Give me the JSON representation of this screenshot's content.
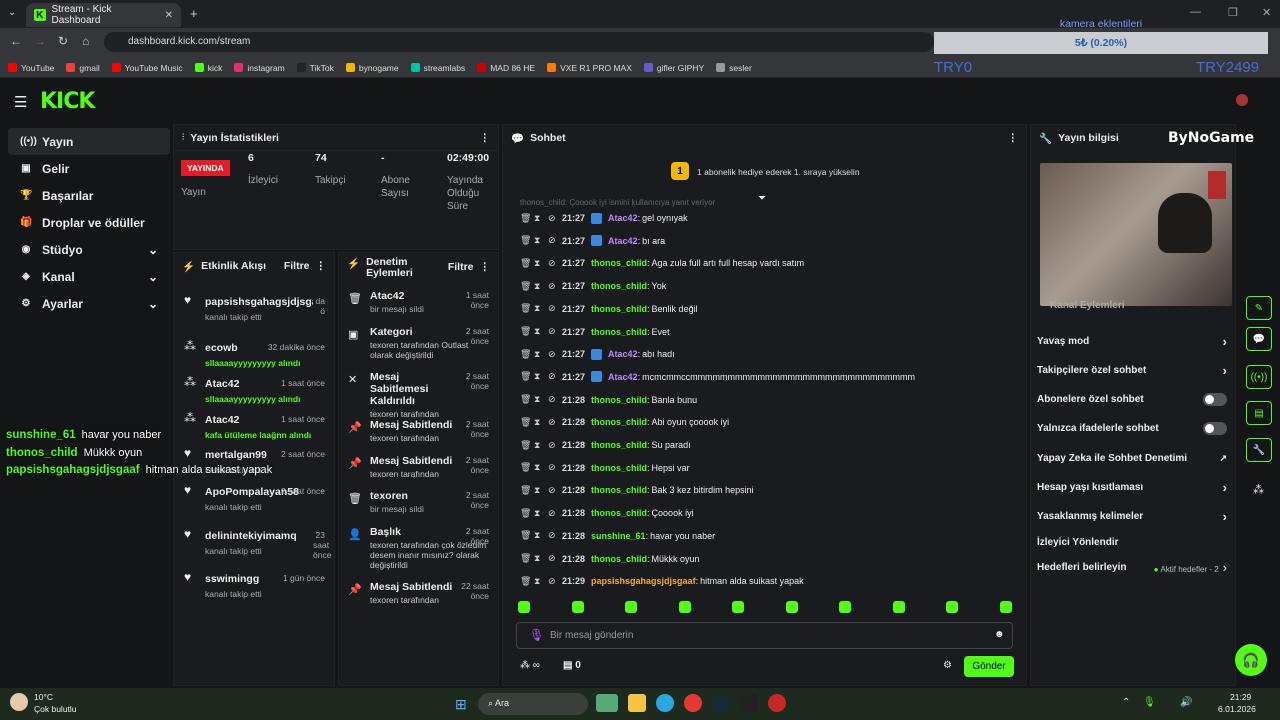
{
  "browser": {
    "tab_title": "Stream - Kick Dashboard",
    "url": "dashboard.kick.com/stream",
    "bookmarks": [
      "YouTube",
      "gmail",
      "YouTube Music",
      "kick",
      "instagram",
      "TikTok",
      "bynogame",
      "streamlabs",
      "MAD 86 HE",
      "VXE R1 PRO MAX",
      "gifler GIPHY",
      "sesler"
    ],
    "bookmark_colors": [
      "#ff0000",
      "#ea4335",
      "#ff0000",
      "#53fc18",
      "#e1306c",
      "#222",
      "#f7b500",
      "#00c2a8",
      "#c00",
      "#ff7a00",
      "#6a5acd",
      "#999"
    ]
  },
  "overlay": {
    "title": "kamera eklentileri",
    "bar_text": "5₺ (0.20%)",
    "left_label": "TRY0",
    "right_label": "TRY2499"
  },
  "sidebar": {
    "logo": "KICK",
    "items": [
      {
        "label": "Yayın",
        "icon": "((•))",
        "active": true,
        "chev": ""
      },
      {
        "label": "Gelir",
        "icon": "▣",
        "active": false,
        "chev": ""
      },
      {
        "label": "Başarılar",
        "icon": "🏆",
        "active": false,
        "chev": ""
      },
      {
        "label": "Droplar ve ödüller",
        "icon": "🎁",
        "active": false,
        "chev": ""
      },
      {
        "label": "Stüdyo",
        "icon": "◉",
        "active": false,
        "chev": "⌄"
      },
      {
        "label": "Kanal",
        "icon": "◈",
        "active": false,
        "chev": "⌄"
      },
      {
        "label": "Ayarlar",
        "icon": "⚙",
        "active": false,
        "chev": "⌄"
      }
    ]
  },
  "stats": {
    "title": "Yayın İstatistikleri",
    "live_badge": "YAYINDA",
    "live_label": "Yayın",
    "viewers": "6",
    "viewers_label": "İzleyici",
    "followers": "74",
    "followers_label": "Takipçi",
    "subs": "-",
    "subs_label": "Abone Sayısı",
    "duration": "02:49:00",
    "duration_label": "Yayında Olduğu Süre"
  },
  "activity": {
    "title": "Etkinlik Akışı",
    "filter": "Filtre",
    "items": [
      {
        "name": "papsishsgahagsjdjsgaaf",
        "sub": "kanalı takip etti",
        "time": "da ö",
        "green": false
      },
      {
        "name": "ecowb",
        "sub": "sllaaaayyyyyyyyy alındı",
        "time": "32 dakika önce",
        "green": true
      },
      {
        "name": "Atac42",
        "sub": "sllaaaayyyyyyyyy alındı",
        "time": "1 saat önce",
        "green": true
      },
      {
        "name": "Atac42",
        "sub": "kafa ütüleme laağnn alındı",
        "time": "1 saat önce",
        "green": true
      },
      {
        "name": "mertalgan99",
        "sub": "kanalı takip etti",
        "time": "2 saat önce",
        "green": false
      },
      {
        "name": "ApoPompalayan58",
        "sub": "kanalı takip etti",
        "time": "2 saat önce",
        "green": false
      },
      {
        "name": "delinintekiyimamq",
        "sub": "kanalı takip etti",
        "time": "23 saat önce",
        "green": false
      },
      {
        "name": "sswimingg",
        "sub": "kanalı takip etti",
        "time": "1 gün önce",
        "green": false
      }
    ]
  },
  "moderation": {
    "title": "Denetim Eylemleri",
    "filter": "Filtre",
    "items": [
      {
        "name": "Atac42",
        "sub": "bir mesajı sildi",
        "time": "1 saat önce"
      },
      {
        "name": "Kategori",
        "sub": "texoren tarafından Outlast olarak değiştirildi",
        "time": "2 saat önce"
      },
      {
        "name": "Mesaj Sabitlemesi Kaldırıldı",
        "sub": "texoren tarafından",
        "time": "2 saat önce"
      },
      {
        "name": "Mesaj Sabitlendi",
        "sub": "texoren tarafından",
        "time": "2 saat önce"
      },
      {
        "name": "Mesaj Sabitlendi",
        "sub": "texoren tarafından",
        "time": "2 saat önce"
      },
      {
        "name": "texoren",
        "sub": "bir mesajı sildi",
        "time": "2 saat önce"
      },
      {
        "name": "Başlık",
        "sub": "texoren tarafından çok özledim desem inanır mısınız? olarak değiştirildi",
        "time": "2 saat önce"
      },
      {
        "name": "Mesaj Sabitlendi",
        "sub": "texoren tarafından",
        "time": "22 saat önce"
      }
    ]
  },
  "chat": {
    "title": "Sohbet",
    "banner": "1 abonelik hediye ederek 1. sıraya yükselin",
    "banner_rank": "1",
    "faded": "thonos_child: Çooook iyi ismini kullanıcıya yanıt veriyor",
    "messages": [
      {
        "time": "21:27",
        "user": "Atac42",
        "text": "gel oynıyak",
        "cls": "u-purple",
        "badge": true
      },
      {
        "time": "21:27",
        "user": "Atac42",
        "text": "bı ara",
        "cls": "u-purple",
        "badge": true
      },
      {
        "time": "21:27",
        "user": "thonos_child",
        "text": "Aga zula full artı full hesap vardı satım",
        "cls": "u-green",
        "badge": false
      },
      {
        "time": "21:27",
        "user": "thonos_child",
        "text": "Yok",
        "cls": "u-green",
        "badge": false
      },
      {
        "time": "21:27",
        "user": "thonos_child",
        "text": "Benlik değil",
        "cls": "u-green",
        "badge": false
      },
      {
        "time": "21:27",
        "user": "thonos_child",
        "text": "Evet",
        "cls": "u-green",
        "badge": false
      },
      {
        "time": "21:27",
        "user": "Atac42",
        "text": "abı hadı",
        "cls": "u-purple",
        "badge": true
      },
      {
        "time": "21:27",
        "user": "Atac42",
        "text": "mcmcmmccmmmmmmmmmmmmmmmmmmmmmmmmmmmmmm",
        "cls": "u-purple",
        "badge": true
      },
      {
        "time": "21:28",
        "user": "thonos_child",
        "text": "Banla bunu",
        "cls": "u-green",
        "badge": false
      },
      {
        "time": "21:28",
        "user": "thonos_child",
        "text": "Abi oyun çooook iyi",
        "cls": "u-green",
        "badge": false
      },
      {
        "time": "21:28",
        "user": "thonos_child",
        "text": "Su paradı",
        "cls": "u-green",
        "badge": false
      },
      {
        "time": "21:28",
        "user": "thonos_child",
        "text": "Hepsi var",
        "cls": "u-green",
        "badge": false
      },
      {
        "time": "21:28",
        "user": "thonos_child",
        "text": "Bak 3 kez bitirdim hepsini",
        "cls": "u-green",
        "badge": false
      },
      {
        "time": "21:28",
        "user": "thonos_child",
        "text": "Çooook iyi",
        "cls": "u-green",
        "badge": false
      },
      {
        "time": "21:28",
        "user": "sunshine_61",
        "text": "havar you naber",
        "cls": "u-green",
        "badge": false
      },
      {
        "time": "21:28",
        "user": "thonos_child",
        "text": "Mükkk oyun",
        "cls": "u-green",
        "badge": false
      },
      {
        "time": "21:29",
        "user": "papsishsgahagsjdjsgaaf",
        "text": "hitman alda suikast yapak",
        "cls": "u-pink",
        "badge": false
      }
    ],
    "input_placeholder": "Bir mesaj gönderin",
    "points": "∞",
    "store_count": "0",
    "send": "Gönder"
  },
  "info": {
    "title": "Yayın bilgisi",
    "brand": "ByNoGame",
    "partial": "Kanal Eylemleri",
    "settings": [
      {
        "label": "Yavaş mod",
        "ctrl": "chev"
      },
      {
        "label": "Takipçilere özel sohbet",
        "ctrl": "chev"
      },
      {
        "label": "Abonelere özel sohbet",
        "ctrl": "toggle"
      },
      {
        "label": "Yalnızca ifadelerle sohbet",
        "ctrl": "toggle"
      },
      {
        "label": "Yapay Zeka ile Sohbet Denetimi",
        "ctrl": "ext"
      },
      {
        "label": "Hesap yaşı kısıtlaması",
        "ctrl": "chev"
      },
      {
        "label": "Yasaklanmış kelimeler",
        "ctrl": "chev"
      },
      {
        "label": "İzleyici Yönlendir",
        "ctrl": ""
      },
      {
        "label": "Hedefleri belirleyin",
        "ctrl": "goal"
      }
    ],
    "goal_text": "Aktif hedefler - 2"
  },
  "overlay_chat": [
    {
      "user": "sunshine_61",
      "text": "havar you naber"
    },
    {
      "user": "thonos_child",
      "text": "Mükkk oyun"
    },
    {
      "user": "papsishsgahagsjdjsgaaf",
      "text": "hitman alda suikast yapak"
    }
  ],
  "taskbar": {
    "temp": "10°C",
    "weather": "Çok bulutlu",
    "search": "Ara",
    "time": "21:29",
    "date": "6.01.2026"
  }
}
